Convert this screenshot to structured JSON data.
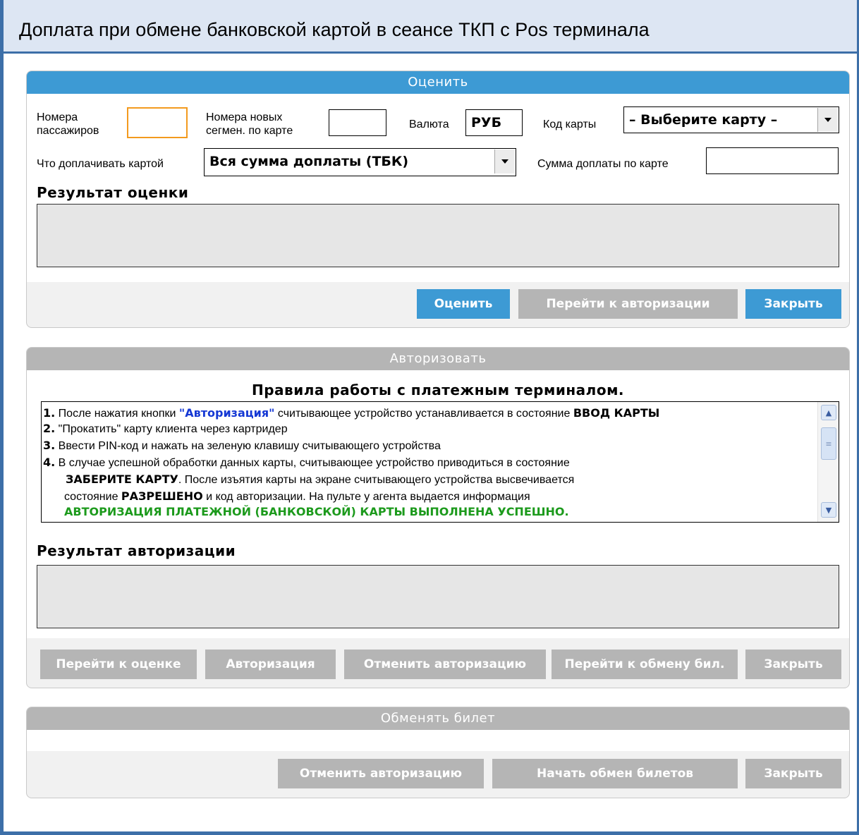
{
  "window": {
    "title": "Доплата при обмене банковской картой в сеансе ТКП с Pos терминала"
  },
  "evaluate": {
    "header": "Оценить",
    "passengers_label": "Номера\nпассажиров",
    "passengers_label_1": "Номера",
    "passengers_label_2": "пассажиров",
    "passengers_value": "",
    "segments_label_1": "Номера новых",
    "segments_label_2": "сегмен. по карте",
    "segments_value": "",
    "currency_label": "Валюта",
    "currency_value": "РУБ",
    "card_code_label": "Код карты",
    "card_code_value": "– Выберите карту –",
    "pay_what_label": "Что доплачивать картой",
    "pay_what_value": "Вся сумма доплаты (ТБК)",
    "card_sum_label": "Сумма доплаты по карте",
    "card_sum_value": "",
    "result_title": "Результат оценки",
    "result_value": "",
    "buttons": {
      "evaluate": "Оценить",
      "go_auth": "Перейти к авторизации",
      "close": "Закрыть"
    }
  },
  "authorize": {
    "header": "Авторизовать",
    "rules_title": "Правила работы с платежным терминалом.",
    "rules": {
      "r1_num": "1.",
      "r1_a": "После нажатия кнопки ",
      "r1_kw": "\"Авторизация\"",
      "r1_b": " считывающее устройство устанавливается в состояние ",
      "r1_bold": "ВВОД КАРТЫ",
      "r2_num": "2.",
      "r2": "\"Прокатить\" карту клиента через картридер",
      "r3_num": "3.",
      "r3": "Ввести PIN-код и нажать на зеленую клавишу считывающего устройства",
      "r4_num": "4.",
      "r4_a": "В случае успешной обработки данных карты, считывающее устройство приводиться в состояние",
      "r4_bold1": "ЗАБЕРИТЕ КАРТУ",
      "r4_b": ". После изъятия карты на экране считывающего устройства высвечивается",
      "r4_c": "состояние ",
      "r4_bold2": "РАЗРЕШЕНО",
      "r4_d": " и код авторизации. На пульте у агента выдается информация",
      "r4_green": "АВТОРИЗАЦИЯ ПЛАТЕЖНОЙ (БАНКОВСКОЙ) КАРТЫ ВЫПОЛНЕНА УСПЕШНО."
    },
    "result_title": "Результат авторизации",
    "result_value": "",
    "buttons": {
      "go_eval": "Перейти к оценке",
      "authorize": "Авторизация",
      "cancel_auth": "Отменить авторизацию",
      "go_exchange": "Перейти к обмену бил.",
      "close": "Закрыть"
    }
  },
  "exchange": {
    "header": "Обменять билет",
    "buttons": {
      "cancel_auth": "Отменить авторизацию",
      "start_exchange": "Начать обмен билетов",
      "close": "Закрыть"
    }
  },
  "colors": {
    "window_border": "#3d6fa8",
    "title_bar_bg": "#dde6f3",
    "active_accent": "#3d9ad4",
    "inactive_gray": "#b5b5b5",
    "focus_border": "#f39a1e",
    "keyword_blue": "#1538d4",
    "success_green": "#1c9a1c"
  },
  "icons": {
    "dropdown": "chevron-down-icon",
    "scroll_up": "arrow-up-icon",
    "scroll_down": "arrow-down-icon",
    "scroll_thumb": "grip-icon"
  }
}
